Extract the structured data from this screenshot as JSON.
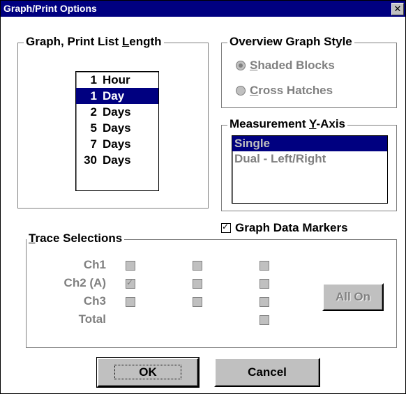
{
  "window": {
    "title": "Graph/Print Options",
    "close_glyph": "✕"
  },
  "list_length": {
    "label_prefix": "Graph, Print List ",
    "label_accel": "L",
    "label_suffix": "ength",
    "items": [
      {
        "num": "1",
        "unit": "Hour"
      },
      {
        "num": "1",
        "unit": "Day"
      },
      {
        "num": "2",
        "unit": "Days"
      },
      {
        "num": "5",
        "unit": "Days"
      },
      {
        "num": "7",
        "unit": "Days"
      },
      {
        "num": "30",
        "unit": "Days"
      }
    ],
    "selected": "1 Day"
  },
  "overview_style": {
    "label": "Overview Graph Style",
    "options": [
      {
        "accel": "S",
        "rest": "haded Blocks",
        "checked": true
      },
      {
        "accel": "C",
        "rest": "ross Hatches",
        "checked": false
      }
    ]
  },
  "y_axis": {
    "label_prefix": "Measurement ",
    "label_accel": "Y",
    "label_suffix": "-Axis",
    "items": [
      "Single",
      "Dual - Left/Right"
    ],
    "selected": "Single"
  },
  "graph_markers": {
    "label": "Graph Data Markers",
    "checked": true
  },
  "trace": {
    "label_accel": "T",
    "label_rest": "race Selections",
    "channels": [
      "Ch1",
      "Ch2 (A)",
      "Ch3",
      "Total"
    ],
    "all_on_label": "All On"
  },
  "buttons": {
    "ok": "OK",
    "cancel": "Cancel"
  }
}
